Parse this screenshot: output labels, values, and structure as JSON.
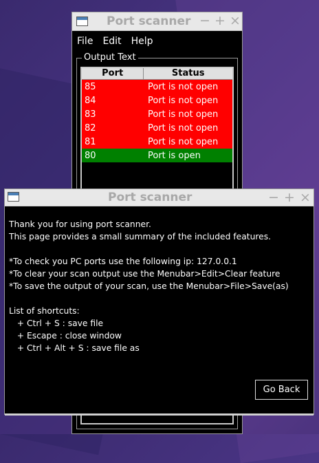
{
  "back_window": {
    "title": "Port scanner",
    "controls": {
      "minimize": "−",
      "maximize": "+",
      "close": "×"
    },
    "menu": [
      "File",
      "Edit",
      "Help"
    ],
    "group_label": "Output Text",
    "table": {
      "headers": [
        "Port",
        "Status"
      ],
      "rows": [
        {
          "port": "85",
          "status": "Port is not open",
          "color": "#ff0000"
        },
        {
          "port": "84",
          "status": "Port is not open",
          "color": "#ff0000"
        },
        {
          "port": "83",
          "status": "Port is not open",
          "color": "#ff0000"
        },
        {
          "port": "82",
          "status": "Port is not open",
          "color": "#ff0000"
        },
        {
          "port": "81",
          "status": "Port is not open",
          "color": "#ff0000"
        },
        {
          "port": "80",
          "status": "Port is open",
          "color": "#008000"
        }
      ]
    }
  },
  "front_window": {
    "title": "Port scanner",
    "controls": {
      "minimize": "−",
      "maximize": "+",
      "close": "×"
    },
    "lines": [
      "Thank you for using port scanner.",
      "This page provides a small summary of the included features.",
      "",
      "*To check you PC ports use the following ip: 127.0.0.1",
      "*To clear your scan output use the Menubar>Edit>Clear feature",
      "*To save the output of your scan, use the Menubar>File>Save(as)",
      "",
      "List of shortcuts:",
      "   + Ctrl + S : save file",
      "   + Escape : close window",
      "   + Ctrl + Alt + S : save file as"
    ],
    "button_label": "Go Back"
  }
}
